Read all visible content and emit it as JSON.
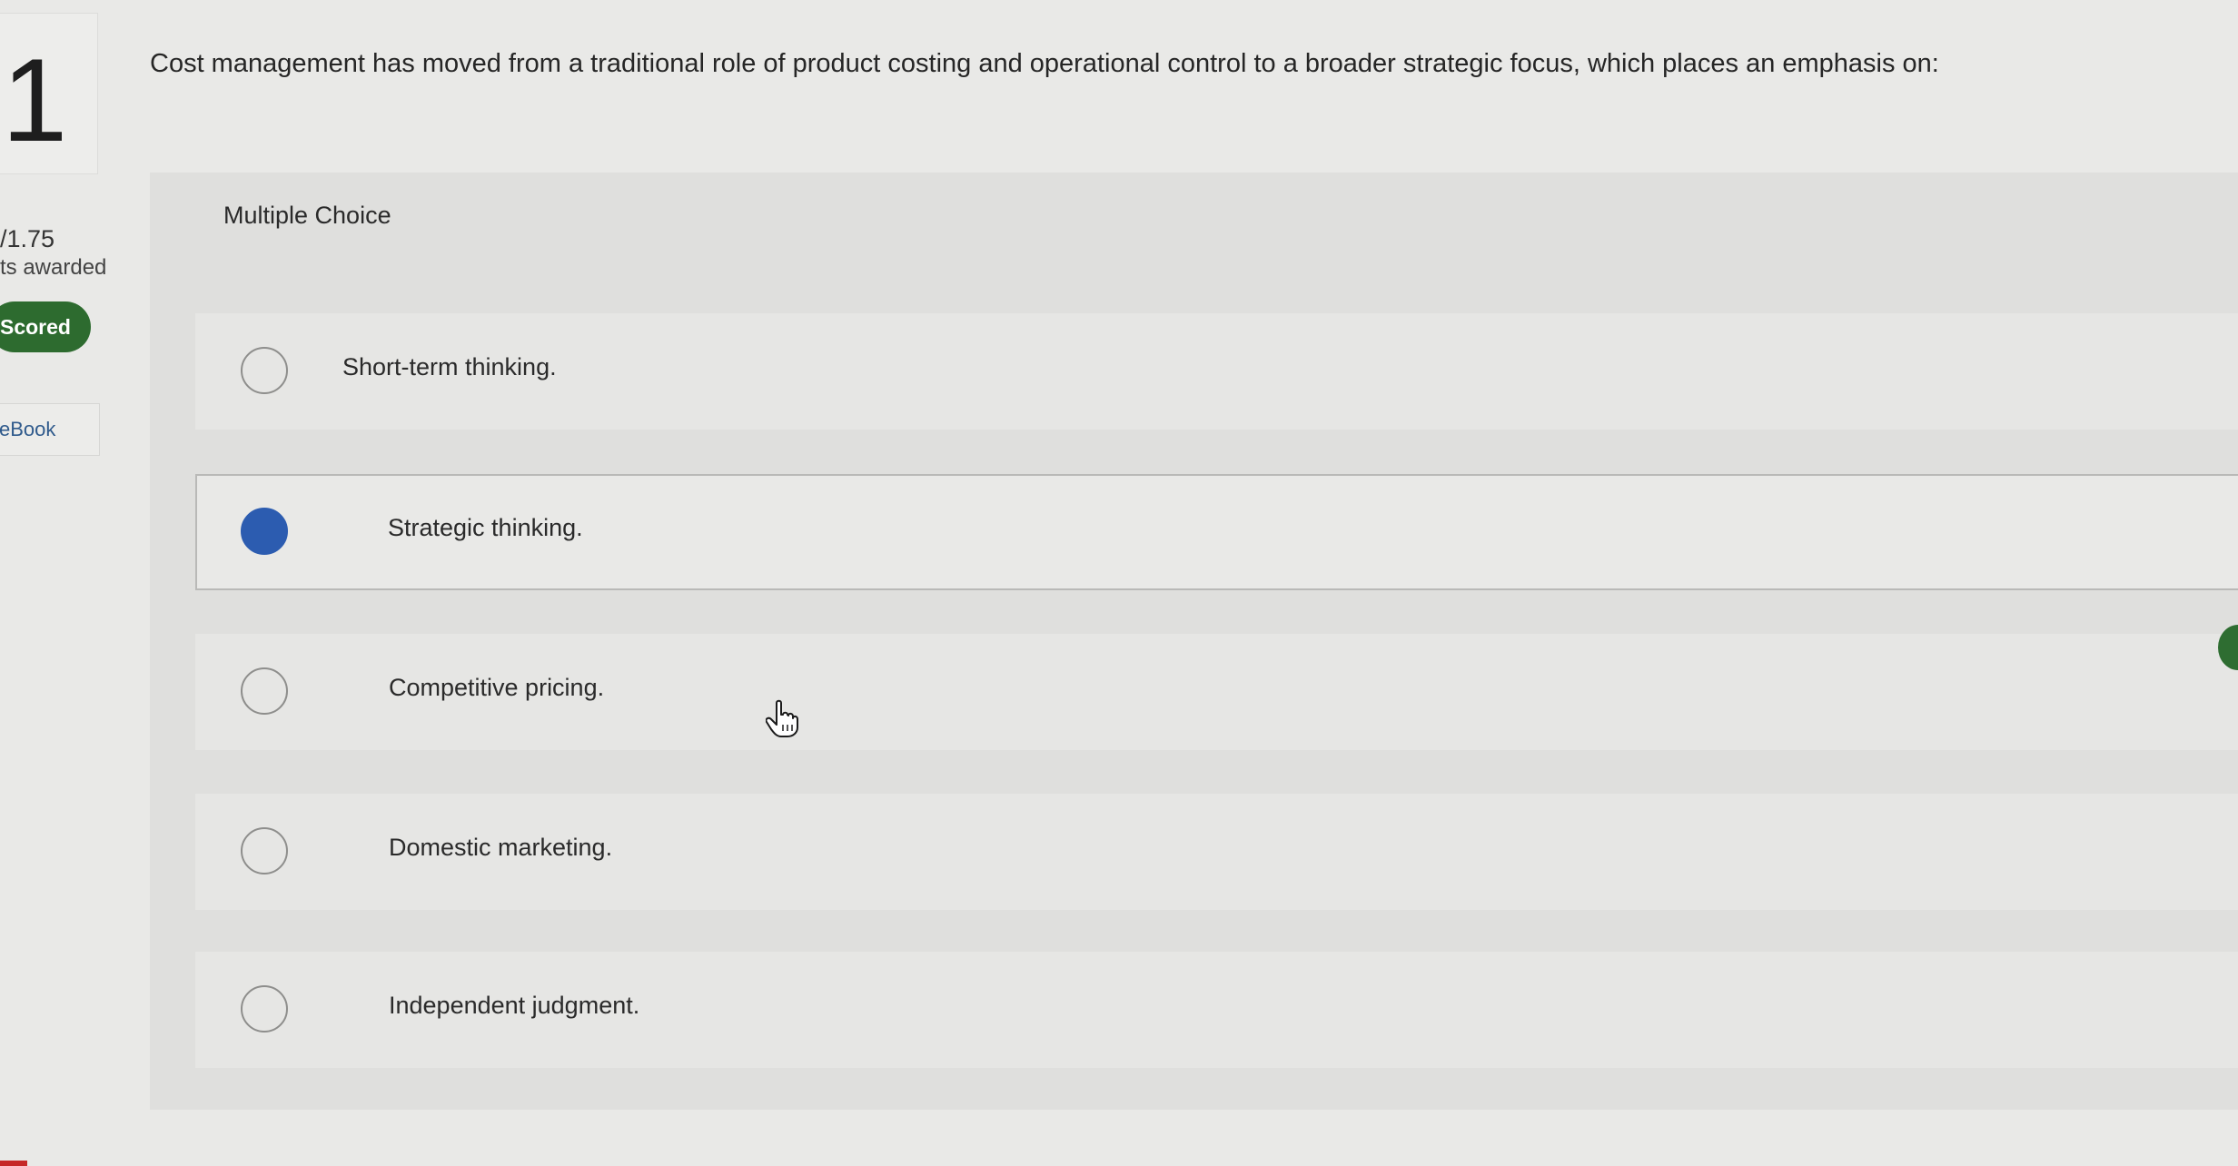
{
  "question": {
    "number": "1",
    "points": "/1.75",
    "points_label": "ts awarded",
    "status_badge": "Scored",
    "ebook_label": "eBook",
    "prompt": "Cost management has moved from a traditional role of product costing and operational control to a broader strategic focus, which places an emphasis on:"
  },
  "answer_panel": {
    "type_label": "Multiple Choice",
    "options": [
      {
        "label": "Short-term thinking.",
        "selected": false
      },
      {
        "label": "Strategic thinking.",
        "selected": true
      },
      {
        "label": "Competitive pricing.",
        "selected": false
      },
      {
        "label": "Domestic marketing.",
        "selected": false
      },
      {
        "label": "Independent judgment.",
        "selected": false
      }
    ]
  },
  "colors": {
    "selected_radio": "#2c5cb0",
    "scored_badge": "#2d6b2f",
    "ebook_link": "#2f5a8c"
  },
  "icons": {
    "cursor": "hand-pointer-icon"
  }
}
